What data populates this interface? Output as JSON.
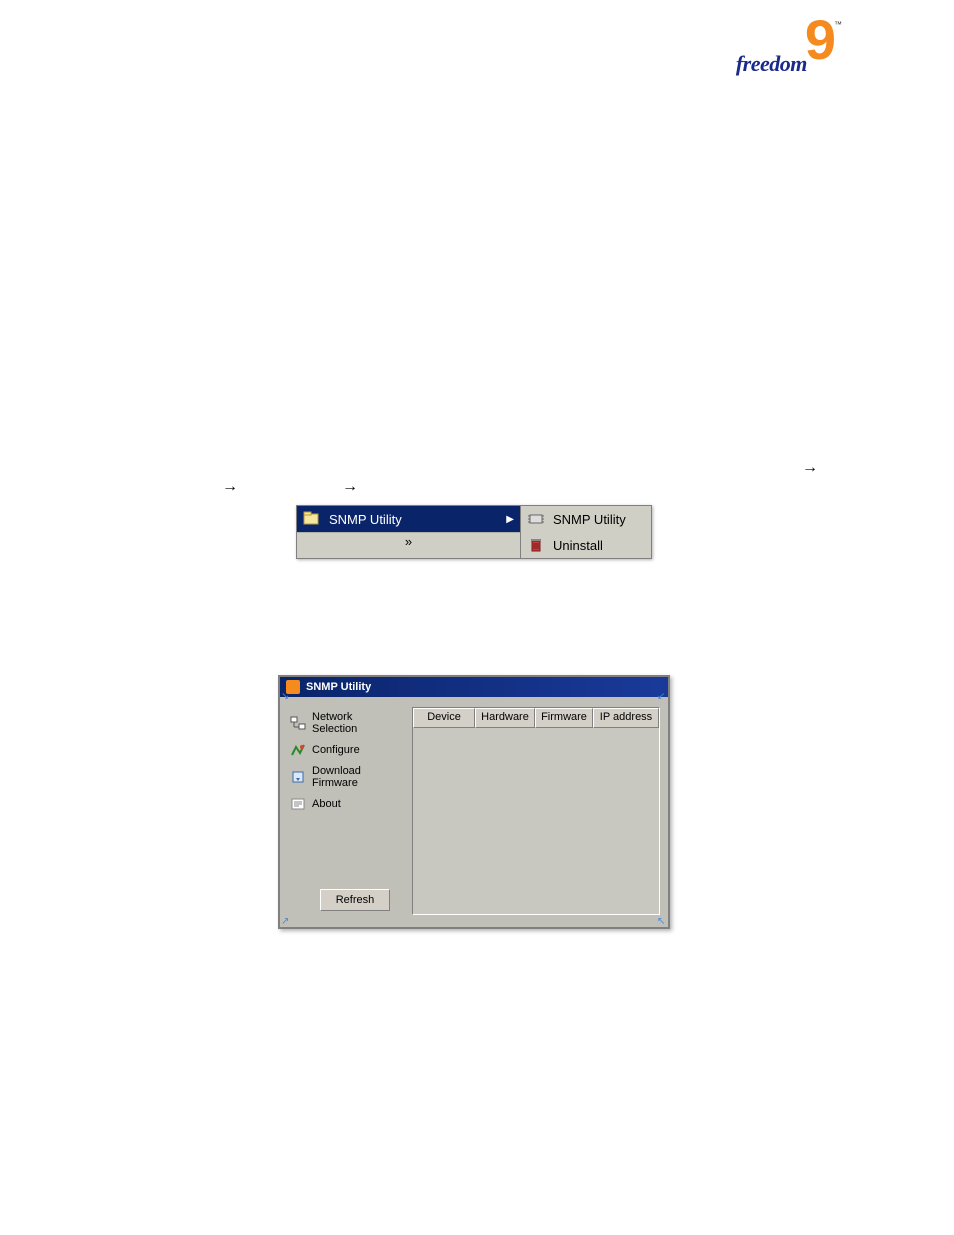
{
  "logo": {
    "brand": "freedom",
    "accent": "9",
    "tm": "™"
  },
  "start_menu": {
    "parent": {
      "label": "SNMP Utility",
      "expand_glyph": "ˇ"
    },
    "submenu": [
      {
        "label": "SNMP Utility",
        "icon": "chip-icon"
      },
      {
        "label": "Uninstall",
        "icon": "trash-icon"
      }
    ]
  },
  "snmp_window": {
    "title": "SNMP Utility",
    "sidebar": [
      {
        "label": "Network Selection",
        "icon": "network-icon"
      },
      {
        "label": "Configure",
        "icon": "configure-icon"
      },
      {
        "label": "Download Firmware",
        "icon": "download-icon"
      },
      {
        "label": "About",
        "icon": "about-icon"
      }
    ],
    "refresh_label": "Refresh",
    "columns": [
      "Device",
      "Hardware",
      "Firmware",
      "IP address"
    ]
  }
}
